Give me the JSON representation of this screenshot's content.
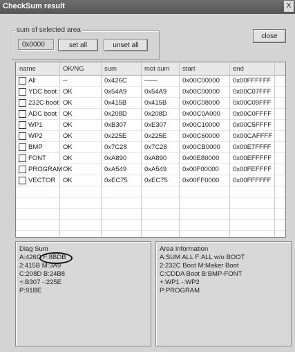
{
  "window": {
    "title": "CheckSum result",
    "close_glyph": "X"
  },
  "sum_group": {
    "label": "sum of selected area",
    "value": "0x0000",
    "set_all": "set all",
    "unset_all": "unset all"
  },
  "close_button": "close",
  "table": {
    "headers": [
      "name",
      "OK/NG",
      "sum",
      "mot sum",
      "start",
      "end"
    ],
    "rows": [
      [
        "All",
        "--",
        "0x426C",
        "------",
        "0x00C00000",
        "0x00FFFFFF"
      ],
      [
        "YDC boot",
        "OK",
        "0x54A9",
        "0x54A9",
        "0x00C00000",
        "0x00C07FFF"
      ],
      [
        "232C boot",
        "OK",
        "0x415B",
        "0x415B",
        "0x00C08000",
        "0x00C09FFF"
      ],
      [
        "ADC boot",
        "OK",
        "0x208D",
        "0x208D",
        "0x00C0A000",
        "0x00C0FFFF"
      ],
      [
        "WP1",
        "OK",
        "0xB307",
        "0xE307",
        "0x00C10000",
        "0x00C5FFFF"
      ],
      [
        "WP2",
        "OK",
        "0x225E",
        "0x225E",
        "0x00C60000",
        "0x00CAFFFF"
      ],
      [
        "BMP",
        "OK",
        "0x7C28",
        "0x7C28",
        "0x00CB0000",
        "0x00E7FFFF"
      ],
      [
        "FONT",
        "OK",
        "0xA890",
        "0xA890",
        "0x00E80000",
        "0x00EFFFFF"
      ],
      [
        "PROGRAM",
        "OK",
        "0xA549",
        "0xA549",
        "0x00F00000",
        "0x00FEFFFF"
      ],
      [
        "VECTOR",
        "OK",
        "0xEC75",
        "0xEC75",
        "0x00FF0000",
        "0x00FFFFFF"
      ]
    ]
  },
  "diag_sum": {
    "title": "Diag Sum",
    "lines": [
      "A:426C F:8BDB",
      "2:415B M:3A9",
      "C:208D B:24B8",
      "+:B307 -:225E",
      "P:91BE"
    ]
  },
  "area_info": {
    "title": "Area Information",
    "lines": [
      "A:SUM  ALL   F:ALL w/o BOOT",
      "2:232C Boot  M:Maker Boot",
      "C:CDDA Boot  B:BMP-FONT",
      "+:WP1       -:WP2",
      "P:PROGRAM"
    ]
  }
}
